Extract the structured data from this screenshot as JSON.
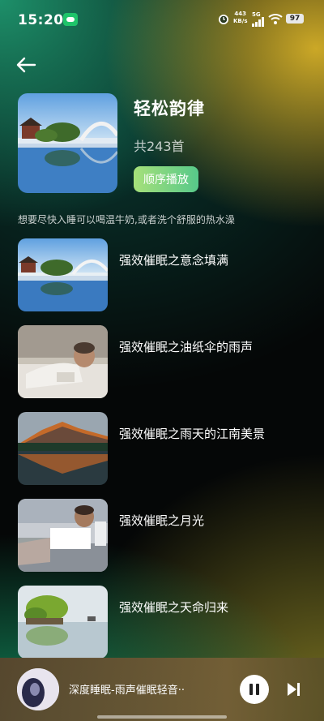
{
  "status_bar": {
    "time": "15:20",
    "speed_value": "443",
    "speed_unit": "KB/s",
    "network": "5G",
    "battery": "97"
  },
  "album": {
    "title": "轻松韵律",
    "count": "共243首",
    "play_label": "顺序播放",
    "description": "想要尽快入睡可以喝温牛奶,或者洗个舒服的热水澡"
  },
  "songs": [
    {
      "title": "强效催眠之意念填满",
      "image": "bridge-lake"
    },
    {
      "title": "强效催眠之油纸伞的雨声",
      "image": "man-lying"
    },
    {
      "title": "强效催眠之雨天的江南美景",
      "image": "mountain-lake"
    },
    {
      "title": "强效催眠之月光",
      "image": "man-in-bed"
    },
    {
      "title": "强效催眠之天命归来",
      "image": "island-lake"
    }
  ],
  "player": {
    "title": "深度睡眠-雨声催眠轻音··"
  },
  "colors": {
    "accent_green": "#57c98a",
    "accent_light": "#a6e07a"
  }
}
